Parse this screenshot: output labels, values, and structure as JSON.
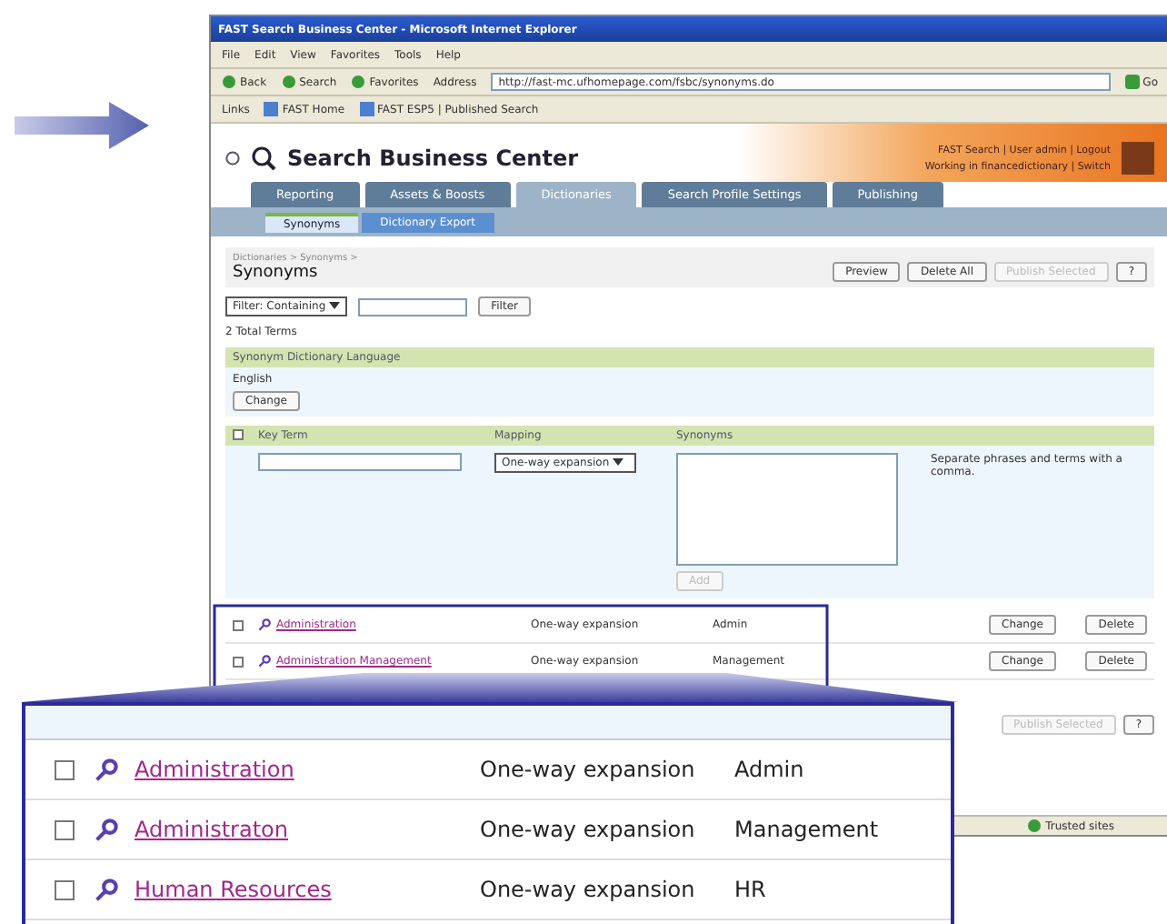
{
  "browser": {
    "title": "FAST Search Business Center - Microsoft Internet Explorer",
    "menu": [
      "File",
      "Edit",
      "View",
      "Favorites",
      "Tools",
      "Help"
    ],
    "toolbar": [
      "Back",
      "Search",
      "Favorites"
    ],
    "address_label": "Address",
    "address": "http://fast-mc.ufhomepage.com/fsbc/synonyms.do",
    "go": "Go",
    "links_label": "Links",
    "links": [
      "FAST Home",
      "FAST ESP5 | Published Search"
    ],
    "status": "Trusted sites"
  },
  "header": {
    "logo": "Search Business Center",
    "user_line": "FAST Search | User admin | Logout",
    "work_line": "Working in financedictionary | Switch"
  },
  "tabs": [
    {
      "label": "Reporting",
      "selected": false
    },
    {
      "label": "Assets & Boosts",
      "selected": false
    },
    {
      "label": "Dictionaries",
      "selected": true
    },
    {
      "label": "Search Profile Settings",
      "selected": false
    },
    {
      "label": "Publishing",
      "selected": false
    }
  ],
  "subtabs": [
    {
      "label": "Synonyms",
      "selected": true
    },
    {
      "label": "Dictionary Export",
      "selected": false
    }
  ],
  "page": {
    "breadcrumb": "Dictionaries > Synonyms >",
    "title": "Synonyms",
    "buttons": [
      {
        "label": "Preview",
        "disabled": false
      },
      {
        "label": "Delete All",
        "disabled": false
      },
      {
        "label": "Publish Selected",
        "disabled": true
      },
      {
        "label": "?",
        "disabled": false
      }
    ],
    "filter_select": "Filter: Containing",
    "filter_button": "Filter",
    "total": "2 Total Terms",
    "language_heading": "Synonym Dictionary Language",
    "language": "English",
    "change": "Change",
    "select_all_checked": false,
    "columns": [
      "Key Term",
      "Mapping",
      "Synonyms"
    ],
    "mapping_value": "One-way expansion",
    "hint": "Separate phrases and terms with a comma.",
    "add": "Add",
    "rows": [
      {
        "term": "Administration",
        "mapping": "One-way expansion",
        "synonyms": "Admin",
        "change": "Change",
        "delete": "Delete",
        "checked": false
      },
      {
        "term": "Administration Management",
        "mapping": "One-way expansion",
        "synonyms": "Management",
        "change": "Change",
        "delete": "Delete",
        "checked": false
      }
    ],
    "bottom_buttons": [
      {
        "label": "Publish Selected",
        "disabled": true
      },
      {
        "label": "?",
        "disabled": false
      }
    ]
  },
  "magnified_rows": [
    {
      "term": "Administration",
      "mapping": "One-way expansion",
      "synonyms": "Admin",
      "checked": false
    },
    {
      "term": "Administraton",
      "mapping": "One-way expansion",
      "synonyms": "Management",
      "checked": false
    },
    {
      "term": "Human Resources",
      "mapping": "One-way expansion",
      "synonyms": "HR",
      "checked": false
    }
  ]
}
